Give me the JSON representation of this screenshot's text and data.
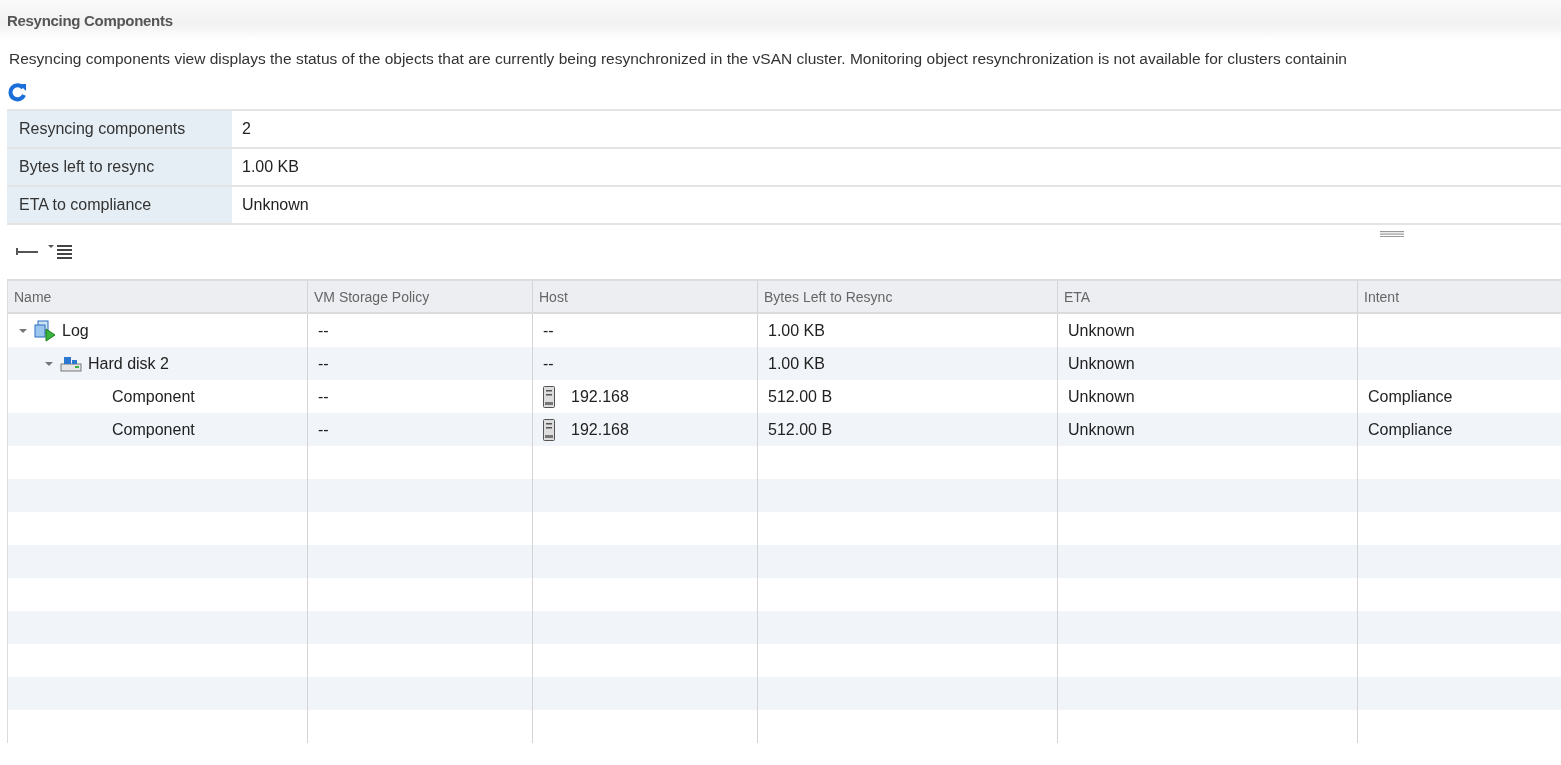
{
  "title": "Resyncing Components",
  "description": "Resyncing components view displays the status of the objects that are currently being resynchronized in the vSAN cluster. Monitoring object resynchronization is not available for clusters containin",
  "summary": [
    {
      "label": "Resyncing components",
      "value": "2"
    },
    {
      "label": "Bytes left to resync",
      "value": "1.00 KB"
    },
    {
      "label": "ETA to compliance",
      "value": "Unknown"
    }
  ],
  "table": {
    "columns": [
      "Name",
      "VM Storage Policy",
      "Host",
      "Bytes Left to Resync",
      "ETA",
      "Intent"
    ],
    "rows": [
      {
        "kind": "vm",
        "name": "Log",
        "expanded": true,
        "policy": "--",
        "host": "--",
        "bytes": "1.00 KB",
        "eta": "Unknown",
        "children": [
          {
            "kind": "disk",
            "name": "Hard disk 2",
            "expanded": true,
            "policy": "--",
            "host": "--",
            "bytes": "1.00 KB",
            "eta": "Unknown",
            "children": [
              {
                "kind": "component",
                "name": "Component",
                "policy": "--",
                "host": "192.168",
                "bytes": "512.00 B",
                "eta": "Unknown",
                "intent": "Compliance"
              },
              {
                "kind": "component",
                "name": "Component",
                "policy": "--",
                "host": "192.168",
                "bytes": "512.00 B",
                "eta": "Unknown",
                "intent": "Compliance"
              }
            ]
          }
        ]
      }
    ]
  }
}
